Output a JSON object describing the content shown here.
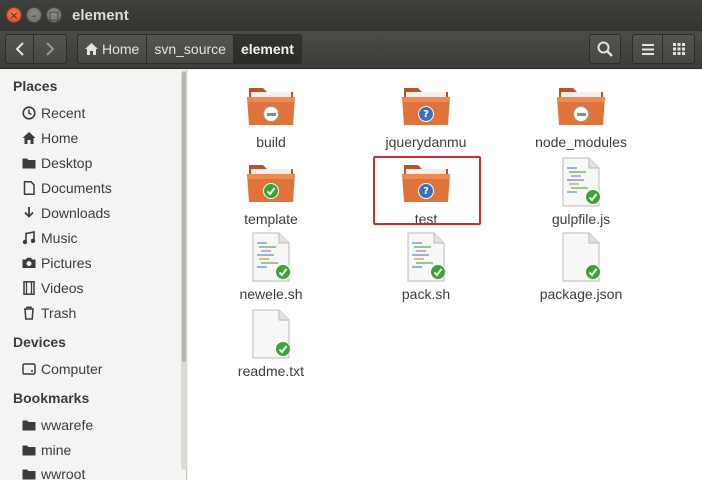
{
  "window": {
    "title": "element"
  },
  "toolbar": {
    "breadcrumbs": [
      "Home",
      "svn_source",
      "element"
    ]
  },
  "sidebar": {
    "headings": [
      "Places",
      "Devices",
      "Bookmarks"
    ],
    "places": [
      {
        "label": "Recent",
        "icon": "clock-icon"
      },
      {
        "label": "Home",
        "icon": "home-icon"
      },
      {
        "label": "Desktop",
        "icon": "folder-icon"
      },
      {
        "label": "Documents",
        "icon": "document-icon"
      },
      {
        "label": "Downloads",
        "icon": "download-icon"
      },
      {
        "label": "Music",
        "icon": "music-icon"
      },
      {
        "label": "Pictures",
        "icon": "camera-icon"
      },
      {
        "label": "Videos",
        "icon": "film-icon"
      },
      {
        "label": "Trash",
        "icon": "trash-icon"
      }
    ],
    "devices": [
      {
        "label": "Computer",
        "icon": "drive-icon"
      }
    ],
    "bookmarks": [
      {
        "label": "wwarefe",
        "icon": "folder-icon"
      },
      {
        "label": "mine",
        "icon": "folder-icon"
      },
      {
        "label": "wwroot",
        "icon": "folder-icon"
      }
    ]
  },
  "files": [
    {
      "name": "build",
      "kind": "folder",
      "badge": "ignored"
    },
    {
      "name": "jquerydanmu",
      "kind": "folder",
      "badge": "unversioned"
    },
    {
      "name": "node_modules",
      "kind": "folder",
      "badge": "ignored"
    },
    {
      "name": "template",
      "kind": "folder",
      "badge": "normal"
    },
    {
      "name": "test",
      "kind": "folder",
      "badge": "unversioned"
    },
    {
      "name": "gulpfile.js",
      "kind": "script",
      "badge": "normal"
    },
    {
      "name": "newele.sh",
      "kind": "script",
      "badge": "normal"
    },
    {
      "name": "pack.sh",
      "kind": "script",
      "badge": "normal"
    },
    {
      "name": "package.json",
      "kind": "text",
      "badge": "normal"
    },
    {
      "name": "readme.txt",
      "kind": "text",
      "badge": "normal"
    }
  ],
  "colors": {
    "folder": "#e0733a",
    "folder_dark": "#b5542a",
    "selection_box": "#d12a2a",
    "badge_ok": "#3aa535",
    "badge_unversioned": "#3a6fc2"
  }
}
